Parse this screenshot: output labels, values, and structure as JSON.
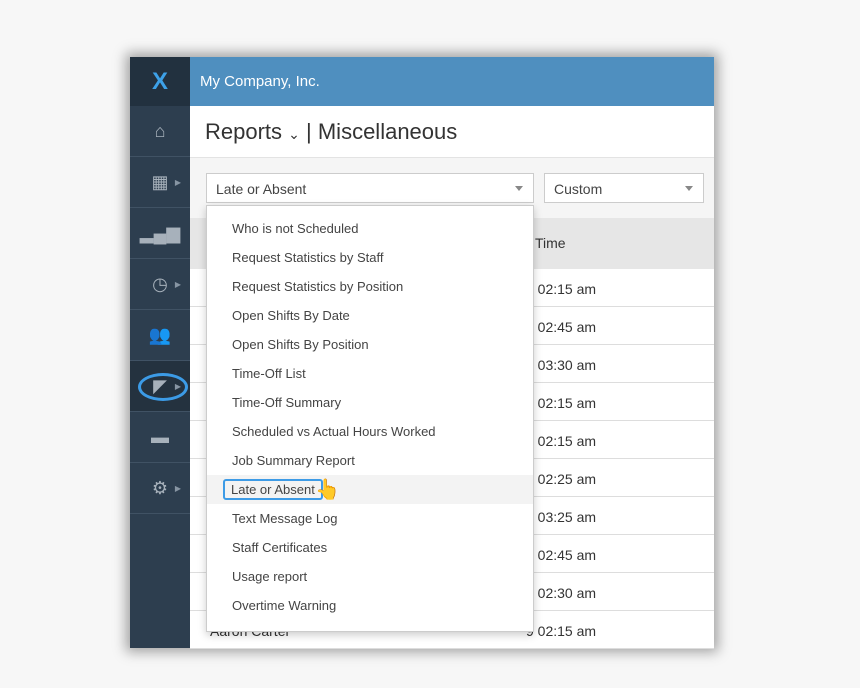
{
  "header": {
    "company": "My Company, Inc.",
    "title": "Reports",
    "subtitle": "| Miscellaneous"
  },
  "sidebar": {
    "items": [
      {
        "icon": "home-icon"
      },
      {
        "icon": "calendar-icon"
      },
      {
        "icon": "bar-chart-icon"
      },
      {
        "icon": "clock-icon"
      },
      {
        "icon": "users-icon"
      },
      {
        "icon": "area-chart-icon",
        "active": true
      },
      {
        "icon": "chat-icon"
      },
      {
        "icon": "gear-icon"
      }
    ]
  },
  "filters": {
    "report": "Late or Absent",
    "range": "Custom"
  },
  "table": {
    "columns": [
      "",
      "Time"
    ],
    "rows": [
      {
        "name": "",
        "time": "9 02:15 am"
      },
      {
        "name": "",
        "time": "9 02:45 am"
      },
      {
        "name": "",
        "time": "9 03:30 am"
      },
      {
        "name": "",
        "time": "9 02:15 am"
      },
      {
        "name": "",
        "time": "9 02:15 am"
      },
      {
        "name": "",
        "time": "9 02:25 am"
      },
      {
        "name": "",
        "time": "9 03:25 am"
      },
      {
        "name": "",
        "time": "9 02:45 am"
      },
      {
        "name": "",
        "time": "9 02:30 am"
      },
      {
        "name": "Aaron                Carter",
        "time": "9 02:15 am"
      }
    ]
  },
  "dropdown": {
    "items": [
      "Who is not Scheduled",
      "Request Statistics by Staff",
      "Request Statistics by Position",
      "Open Shifts By Date",
      "Open Shifts By Position",
      "Time-Off List",
      "Time-Off Summary",
      "Scheduled vs Actual Hours Worked",
      "Job Summary Report",
      "Late or Absent",
      "Text Message Log",
      "Staff Certificates",
      "Usage report",
      "Overtime Warning"
    ],
    "selected": "Late or Absent"
  },
  "colors": {
    "topbar": "#4f8fbf",
    "sidebar": "#2d3e4f",
    "highlight": "#3d9be6"
  }
}
